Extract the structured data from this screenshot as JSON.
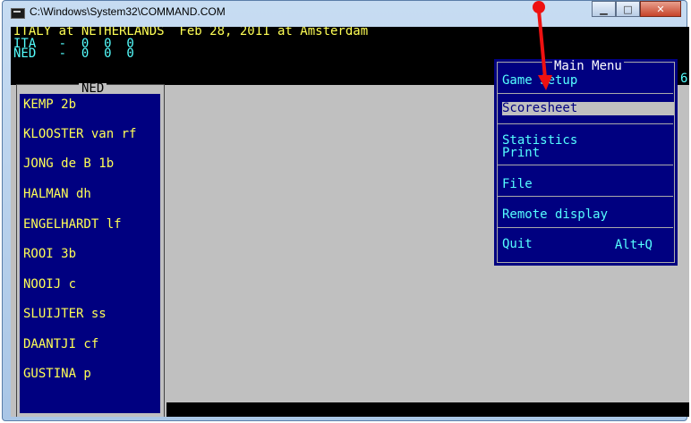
{
  "window": {
    "title": "C:\\Windows\\System32\\COMMAND.COM"
  },
  "header": {
    "line1": "ITALY at NETHERLANDS  Feb 28, 2011 at Amsterdam",
    "line2": "ITA   -  0  0  0",
    "line3": "NED   -  0  0  0"
  },
  "ned": {
    "label": "NED",
    "players": [
      "KEMP 2b",
      "KLOOSTER van rf",
      "JONG de B 1b",
      "HALMAN dh",
      "ENGELHARDT lf",
      "ROOI 3b",
      "NOOIJ c",
      "SLUIJTER ss",
      "DAANTJI cf",
      "GUSTINA p"
    ]
  },
  "menu": {
    "title": "Main Menu",
    "items": {
      "game_setup": "Game Setup",
      "scoresheet": "Scoresheet",
      "statistics": "Statistics",
      "print": "Print",
      "file": "File",
      "remote_display": "Remote display",
      "quit": "Quit",
      "quit_shortcut": "Alt+Q"
    }
  },
  "edge_char": "6",
  "colors": {
    "console_text": "#ffff55",
    "menu_text": "#55ffff",
    "panel_bg": "#000080",
    "console_bg": "#c0c0c0",
    "pointer": "#ff0000"
  }
}
